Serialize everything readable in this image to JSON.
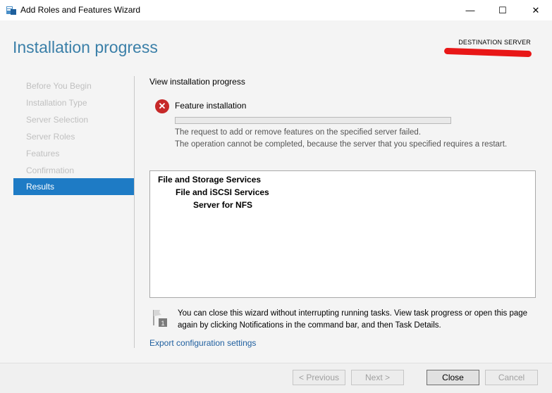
{
  "window": {
    "title": "Add Roles and Features Wizard",
    "minimize_glyph": "—",
    "maximize_glyph": "☐",
    "close_glyph": "✕"
  },
  "header": {
    "title": "Installation progress",
    "destination_label": "DESTINATION SERVER",
    "accent_color": "#3a7fa8"
  },
  "nav": {
    "items": [
      {
        "label": "Before You Begin",
        "active": false
      },
      {
        "label": "Installation Type",
        "active": false
      },
      {
        "label": "Server Selection",
        "active": false
      },
      {
        "label": "Server Roles",
        "active": false
      },
      {
        "label": "Features",
        "active": false
      },
      {
        "label": "Confirmation",
        "active": false
      },
      {
        "label": "Results",
        "active": true
      }
    ],
    "active_color": "#1e7bc5"
  },
  "main": {
    "section_label": "View installation progress",
    "feature_status": {
      "icon": "error-icon",
      "icon_glyph": "✕",
      "title": "Feature installation",
      "progress": 0,
      "error_line1": "The request to add or remove features on the specified server failed.",
      "error_line2": "The operation cannot be completed, because the server that you specified requires a restart."
    },
    "feature_tree": [
      {
        "label": "File and Storage Services",
        "level": 1
      },
      {
        "label": "File and iSCSI Services",
        "level": 2
      },
      {
        "label": "Server for NFS",
        "level": 3
      }
    ],
    "note_icon": "flag-notification-icon",
    "note_text": "You can close this wizard without interrupting running tasks. View task progress or open this page again by clicking Notifications in the command bar, and then Task Details.",
    "export_link": "Export configuration settings"
  },
  "footer": {
    "previous_label": "< Previous",
    "next_label": "Next >",
    "close_label": "Close",
    "cancel_label": "Cancel"
  }
}
